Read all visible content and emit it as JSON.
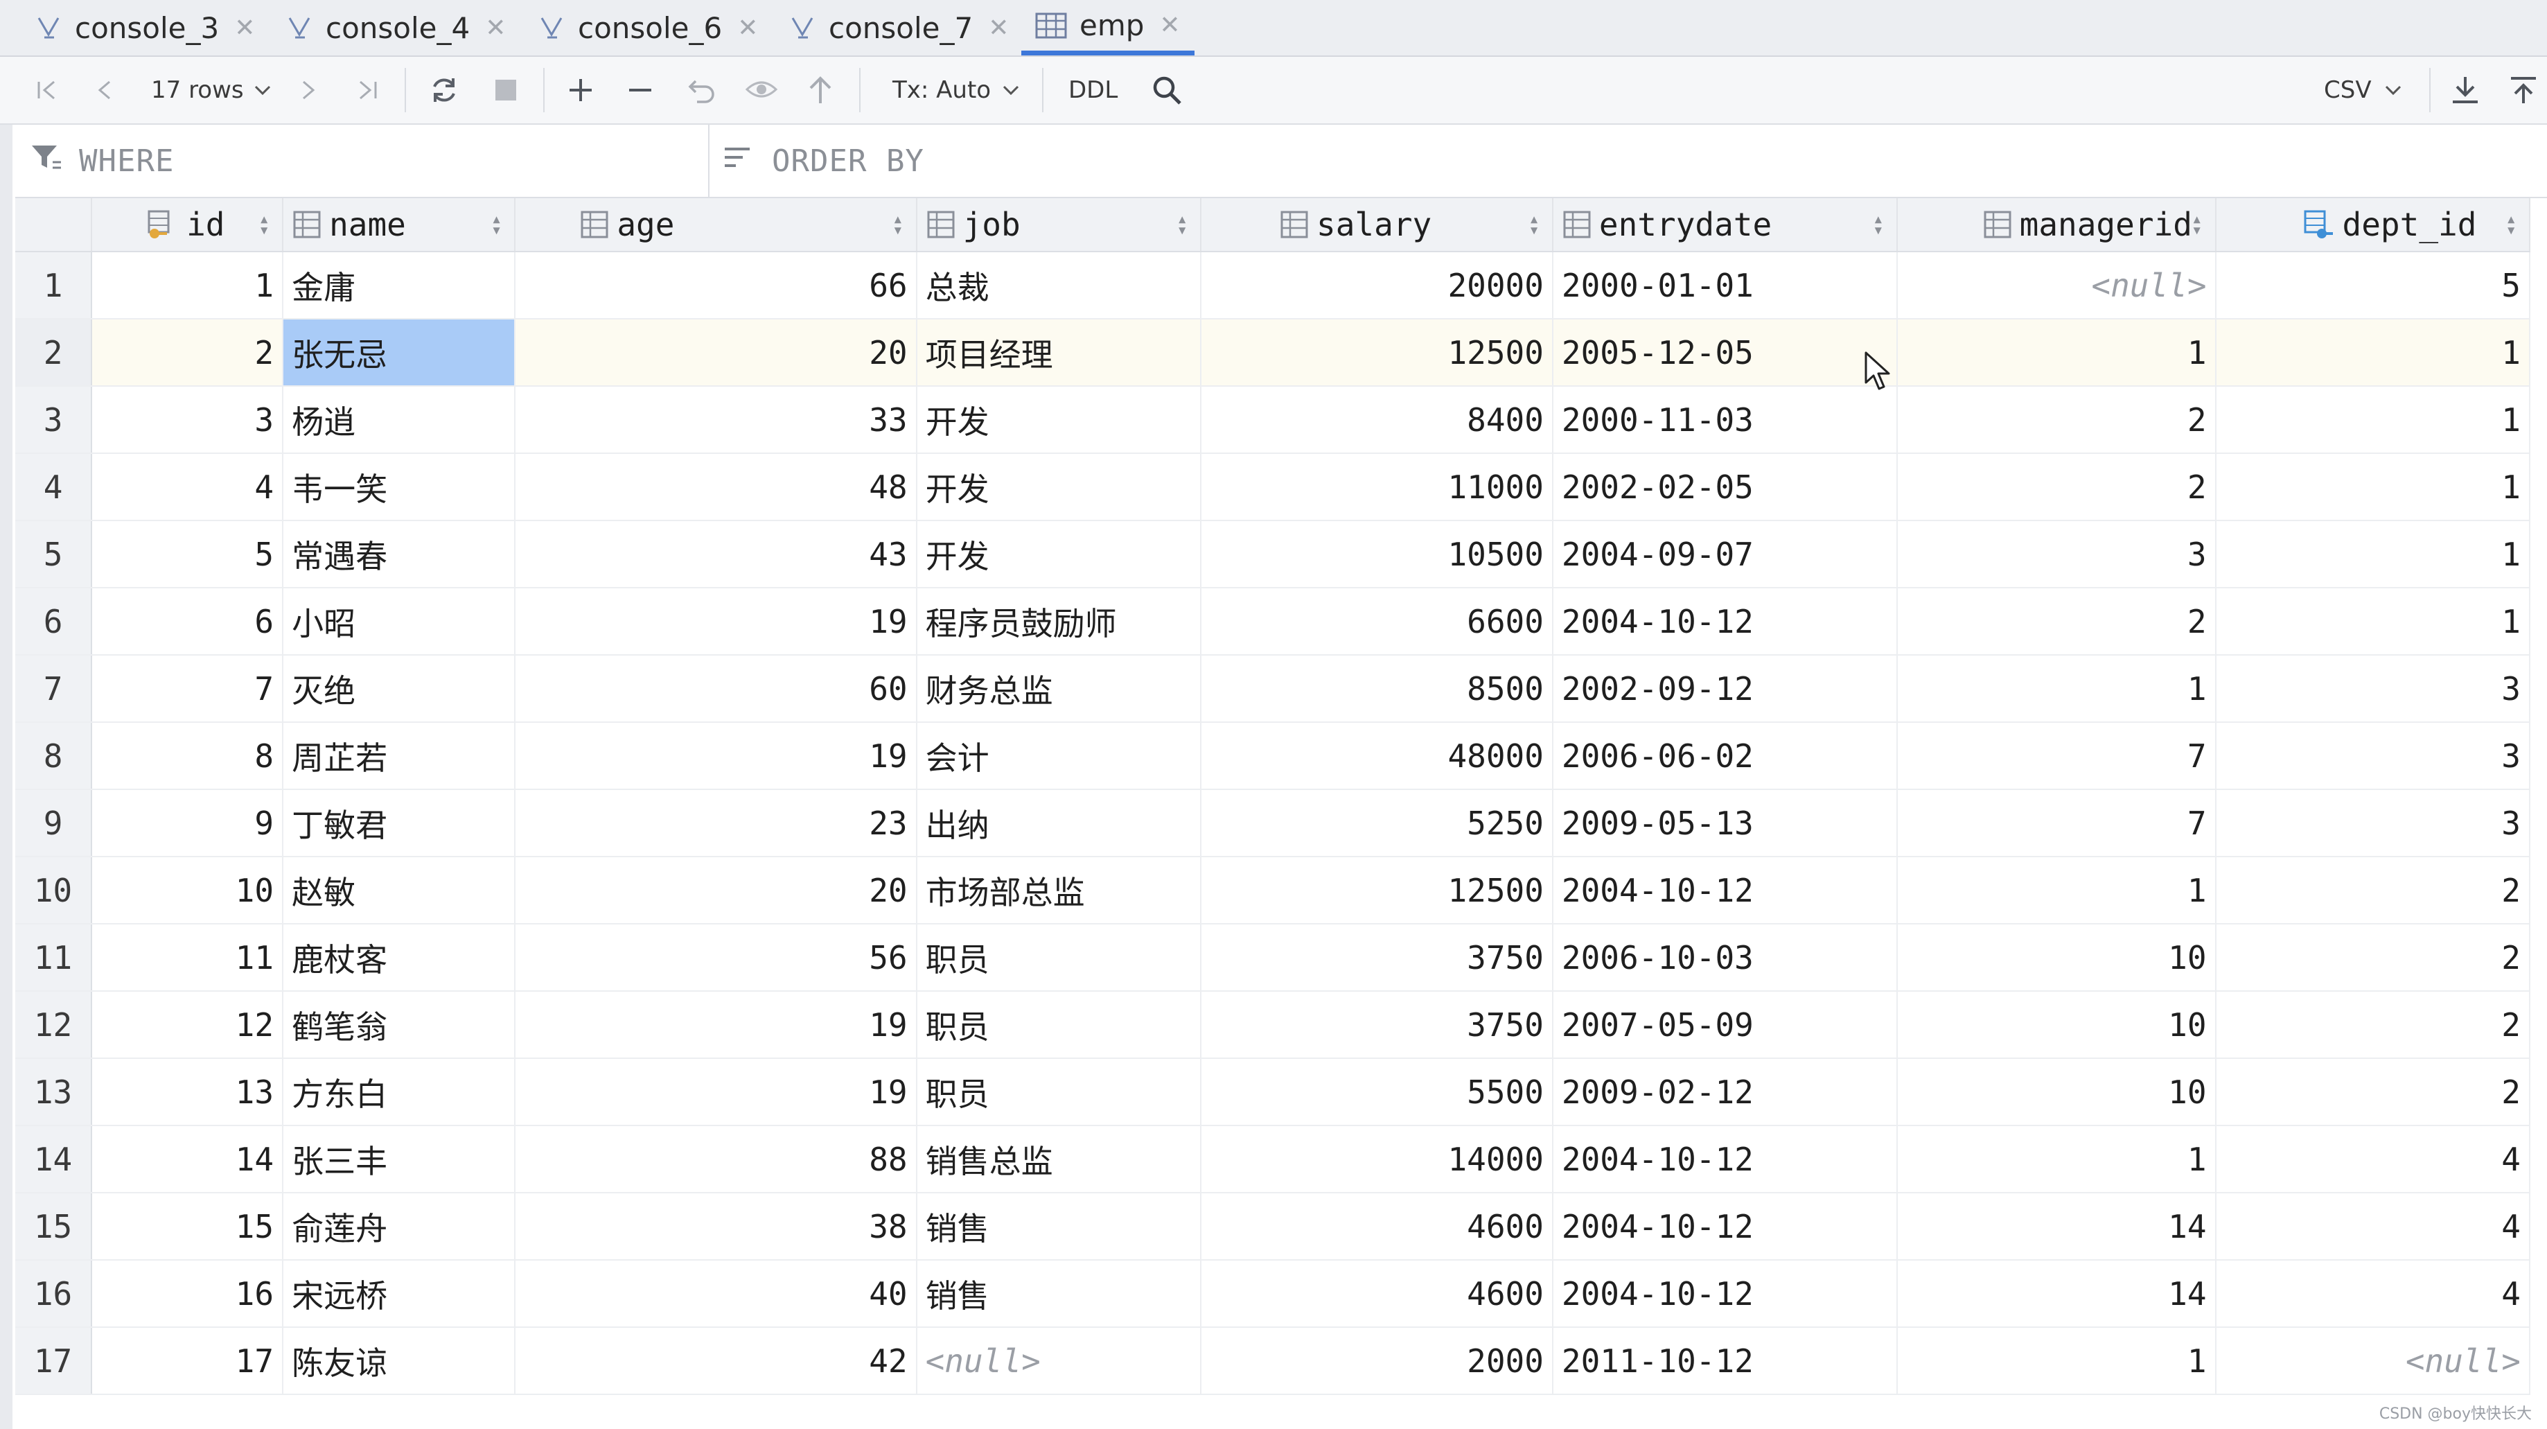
{
  "tabs": [
    {
      "label": "console_3",
      "icon": "console-icon",
      "active": false
    },
    {
      "label": "console_4",
      "icon": "console-icon",
      "active": false
    },
    {
      "label": "console_6",
      "icon": "console-icon",
      "active": false
    },
    {
      "label": "console_7",
      "icon": "console-icon",
      "active": false
    },
    {
      "label": "emp",
      "icon": "table-icon",
      "active": true
    }
  ],
  "toolbar": {
    "rows_label": "17 rows",
    "tx_label": "Tx: Auto",
    "ddl_label": "DDL",
    "export_format": "CSV"
  },
  "filters": {
    "where_label": "WHERE",
    "order_by_label": "ORDER BY"
  },
  "table": {
    "columns": [
      {
        "name": "id",
        "icon": "key-column-icon"
      },
      {
        "name": "name",
        "icon": "column-icon"
      },
      {
        "name": "age",
        "icon": "column-icon"
      },
      {
        "name": "job",
        "icon": "column-icon"
      },
      {
        "name": "salary",
        "icon": "column-icon"
      },
      {
        "name": "entrydate",
        "icon": "column-icon"
      },
      {
        "name": "managerid",
        "icon": "column-icon"
      },
      {
        "name": "dept_id",
        "icon": "foreign-key-column-icon"
      }
    ],
    "rows": [
      {
        "n": "1",
        "id": "1",
        "name": "金庸",
        "age": "66",
        "job": "总裁",
        "salary": "20000",
        "entrydate": "2000-01-01",
        "managerid": "<null>",
        "dept_id": "5"
      },
      {
        "n": "2",
        "id": "2",
        "name": "张无忌",
        "age": "20",
        "job": "项目经理",
        "salary": "12500",
        "entrydate": "2005-12-05",
        "managerid": "1",
        "dept_id": "1"
      },
      {
        "n": "3",
        "id": "3",
        "name": "杨逍",
        "age": "33",
        "job": "开发",
        "salary": "8400",
        "entrydate": "2000-11-03",
        "managerid": "2",
        "dept_id": "1"
      },
      {
        "n": "4",
        "id": "4",
        "name": "韦一笑",
        "age": "48",
        "job": "开发",
        "salary": "11000",
        "entrydate": "2002-02-05",
        "managerid": "2",
        "dept_id": "1"
      },
      {
        "n": "5",
        "id": "5",
        "name": "常遇春",
        "age": "43",
        "job": "开发",
        "salary": "10500",
        "entrydate": "2004-09-07",
        "managerid": "3",
        "dept_id": "1"
      },
      {
        "n": "6",
        "id": "6",
        "name": "小昭",
        "age": "19",
        "job": "程序员鼓励师",
        "salary": "6600",
        "entrydate": "2004-10-12",
        "managerid": "2",
        "dept_id": "1"
      },
      {
        "n": "7",
        "id": "7",
        "name": "灭绝",
        "age": "60",
        "job": "财务总监",
        "salary": "8500",
        "entrydate": "2002-09-12",
        "managerid": "1",
        "dept_id": "3"
      },
      {
        "n": "8",
        "id": "8",
        "name": "周芷若",
        "age": "19",
        "job": "会计",
        "salary": "48000",
        "entrydate": "2006-06-02",
        "managerid": "7",
        "dept_id": "3"
      },
      {
        "n": "9",
        "id": "9",
        "name": "丁敏君",
        "age": "23",
        "job": "出纳",
        "salary": "5250",
        "entrydate": "2009-05-13",
        "managerid": "7",
        "dept_id": "3"
      },
      {
        "n": "10",
        "id": "10",
        "name": "赵敏",
        "age": "20",
        "job": "市场部总监",
        "salary": "12500",
        "entrydate": "2004-10-12",
        "managerid": "1",
        "dept_id": "2"
      },
      {
        "n": "11",
        "id": "11",
        "name": "鹿杖客",
        "age": "56",
        "job": "职员",
        "salary": "3750",
        "entrydate": "2006-10-03",
        "managerid": "10",
        "dept_id": "2"
      },
      {
        "n": "12",
        "id": "12",
        "name": "鹤笔翁",
        "age": "19",
        "job": "职员",
        "salary": "3750",
        "entrydate": "2007-05-09",
        "managerid": "10",
        "dept_id": "2"
      },
      {
        "n": "13",
        "id": "13",
        "name": "方东白",
        "age": "19",
        "job": "职员",
        "salary": "5500",
        "entrydate": "2009-02-12",
        "managerid": "10",
        "dept_id": "2"
      },
      {
        "n": "14",
        "id": "14",
        "name": "张三丰",
        "age": "88",
        "job": "销售总监",
        "salary": "14000",
        "entrydate": "2004-10-12",
        "managerid": "1",
        "dept_id": "4"
      },
      {
        "n": "15",
        "id": "15",
        "name": "俞莲舟",
        "age": "38",
        "job": "销售",
        "salary": "4600",
        "entrydate": "2004-10-12",
        "managerid": "14",
        "dept_id": "4"
      },
      {
        "n": "16",
        "id": "16",
        "name": "宋远桥",
        "age": "40",
        "job": "销售",
        "salary": "4600",
        "entrydate": "2004-10-12",
        "managerid": "14",
        "dept_id": "4"
      },
      {
        "n": "17",
        "id": "17",
        "name": "陈友谅",
        "age": "42",
        "job": "<null>",
        "salary": "2000",
        "entrydate": "2011-10-12",
        "managerid": "1",
        "dept_id": "<null>"
      }
    ],
    "selected_row": 2,
    "selected_column": "name"
  },
  "watermark": "CSDN @boy快快长大",
  "colors": {
    "accent": "#3d77d9",
    "selection": "#a9cbf7",
    "header_bg": "#f0f2f5",
    "null_text": "#9a9ea5"
  }
}
